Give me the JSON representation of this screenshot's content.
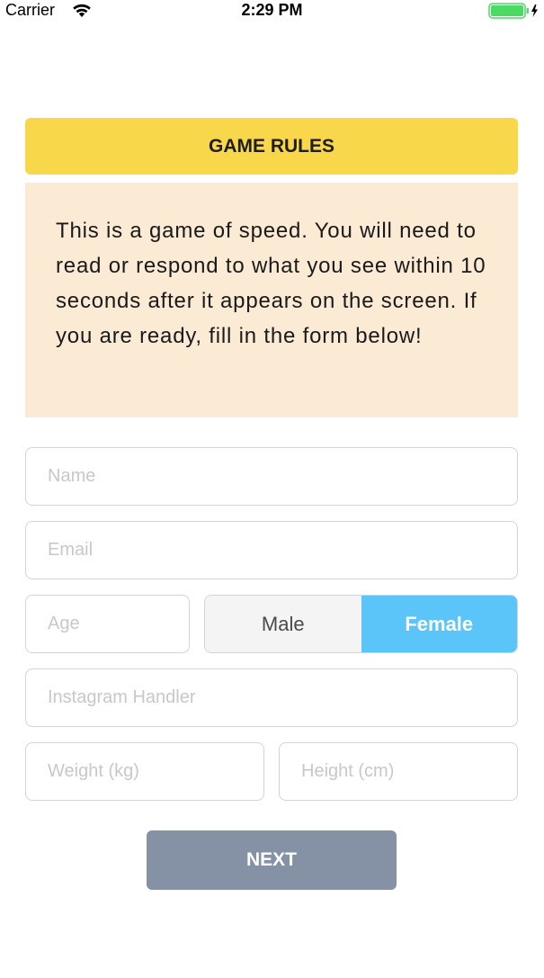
{
  "status_bar": {
    "carrier": "Carrier",
    "time": "2:29 PM",
    "wifi_icon": "wifi-icon",
    "battery_icon": "battery-charging-icon"
  },
  "rules": {
    "title": "GAME RULES",
    "text": "This is a game of speed. You will need to read or respond to what you see within 10 seconds after it appears on the screen. If you are ready, fill in the form below!"
  },
  "form": {
    "name": {
      "placeholder": "Name",
      "value": ""
    },
    "email": {
      "placeholder": "Email",
      "value": ""
    },
    "age": {
      "placeholder": "Age",
      "value": ""
    },
    "gender": {
      "options": [
        "Male",
        "Female"
      ],
      "selected": "Female"
    },
    "instagram": {
      "placeholder": "Instagram Handler",
      "value": ""
    },
    "weight": {
      "placeholder": "Weight (kg)",
      "value": ""
    },
    "height": {
      "placeholder": "Height (cm)",
      "value": ""
    }
  },
  "next_button": {
    "label": "NEXT"
  },
  "colors": {
    "header_bg": "#f9d74a",
    "rules_bg": "#fbebd5",
    "selected_segment": "#5bc4f8",
    "button_bg": "#8592a6",
    "battery": "#4cd964"
  }
}
